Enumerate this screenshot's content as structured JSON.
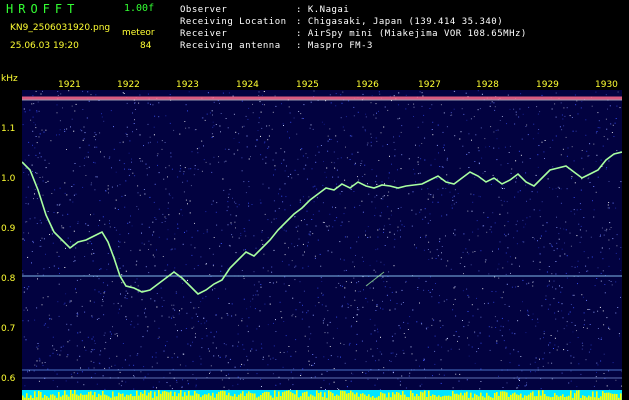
{
  "app": {
    "title": "HROFFT",
    "version": "1.00f"
  },
  "file": {
    "name": "KN9_2506031920.png",
    "datetime": "25.06.03 19:20"
  },
  "meteor": {
    "label": "meteor",
    "count": "84"
  },
  "info": [
    {
      "label": "Observer",
      "value": ": K.Nagai"
    },
    {
      "label": "Receiving Location",
      "value": ": Chigasaki, Japan (139.414 35.340)"
    },
    {
      "label": "Receiver",
      "value": ": AirSpy mini (Miakejima VOR 108.65MHz)"
    },
    {
      "label": "Receiving antenna",
      "value": ": Maspro FM-3"
    }
  ],
  "axes": {
    "y_unit": "kHz",
    "y_ticks": [
      "1.1",
      "1.0",
      "0.9",
      "0.8",
      "0.7",
      "0.6"
    ],
    "x_ticks": [
      "1921",
      "1922",
      "1923",
      "1924",
      "1925",
      "1926",
      "1927",
      "1928",
      "1929",
      "1930"
    ]
  },
  "colors": {
    "tick_text": "#ffff33",
    "title": "#33ff33",
    "trace": "#a8ffa0",
    "noise_bar": "#ffff00",
    "footer_fill": "#00e5ff"
  }
}
